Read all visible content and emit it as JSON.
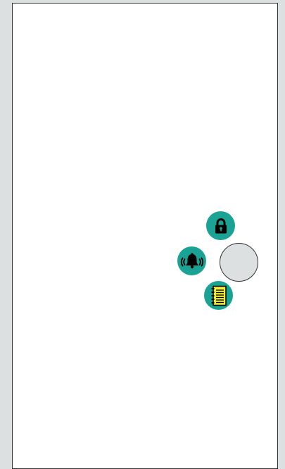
{
  "colors": {
    "background": "#dde0e0",
    "screen": "#ffffff",
    "accent": "#1aa394",
    "note_yellow": "#f2ee3a"
  },
  "fab_menu": {
    "state": "expanded",
    "items": [
      {
        "icon": "lock-icon"
      },
      {
        "icon": "ringing-bell-icon"
      },
      {
        "icon": "notebook-icon"
      }
    ],
    "main_button_icon": ""
  }
}
